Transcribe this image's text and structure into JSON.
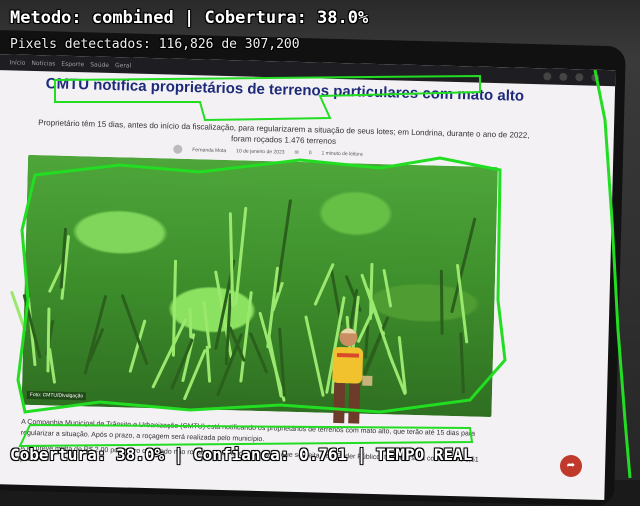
{
  "hud": {
    "method_line": "Metodo: combined | Cobertura: 38.0%",
    "pixels_line": "Pixels detectados: 116,826 de 307,200",
    "status_line": "Cobertura: 38.0% | Confianca: 0.761 | TEMPO REAL",
    "overlay_color": "#22dd22"
  },
  "browser": {
    "tabs": [
      "Início",
      "Notícias",
      "Esporte",
      "Saúde",
      "Geral"
    ]
  },
  "article": {
    "title": "CMTU notifica proprietários de terrenos particulares com mato alto",
    "lead": "Proprietário têm 15 dias, antes do início da fiscalização, para regularizarem a situação de seus lotes; em Londrina, durante o ano de 2022, foram roçados 1.476 terrenos",
    "author": "Fernanda Mota",
    "date": "10 de janeiro de 2023",
    "comments": "0",
    "read_time": "1 minuto de leitura",
    "photo_credit": "Foto: CMTU/Divulgação",
    "body_1": "A Companhia Municipal de Trânsito e Urbanização (CMTU) está notificando os proprietários de terrenos com mato alto, que terão até 15 dias para regularizar a situação. Após o prazo, a roçagem será realizada pelo município.",
    "body_2": "A lei prevê multa de R$ 2,00 por metro quadrado não roçado. Caso a roçagem tiver que ser feita pelo Poder Público, também será cobrado R$ 0,51 por m²."
  }
}
